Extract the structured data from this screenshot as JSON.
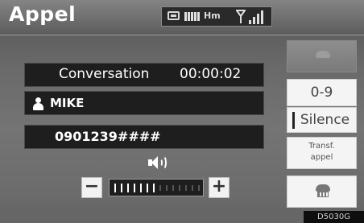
{
  "header": {
    "title": "Appel",
    "status": {
      "phone_icon": "phone-connected-icon",
      "battery_icon": "battery-icon",
      "km_label": "Hm",
      "antenna_icon": "antenna-icon",
      "signal_icon": "signal-strength-icon"
    }
  },
  "call": {
    "status_label": "Conversation",
    "duration": "00:00:02",
    "caller_icon": "person-icon",
    "caller_name": "MIKE",
    "phone_number": "0901239####"
  },
  "volume": {
    "icon": "speaker-icon",
    "minus_label": "−",
    "plus_label": "+",
    "level_fraction": 0.5
  },
  "side_buttons": {
    "top_icon": "handset-icon",
    "keypad_label": "0-9",
    "silence_label": "Silence",
    "transfer_label": "Transf.\nappel",
    "hangup_icon": "hang-up-icon"
  },
  "image_code": "D5030G"
}
